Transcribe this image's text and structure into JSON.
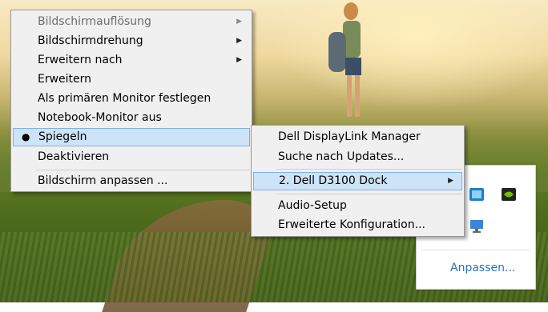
{
  "main_menu": {
    "items": [
      {
        "label": "Bildschirmauflösung",
        "submenu": true,
        "disabled": true
      },
      {
        "label": "Bildschirmdrehung",
        "submenu": true
      },
      {
        "label": "Erweitern nach",
        "submenu": true
      },
      {
        "label": "Erweitern"
      },
      {
        "label": "Als primären Monitor festlegen"
      },
      {
        "label": "Notebook-Monitor aus"
      },
      {
        "label": "Spiegeln",
        "checked": true,
        "selected": true
      },
      {
        "label": "Deaktivieren"
      },
      {
        "label": "Bildschirm anpassen ..."
      }
    ],
    "bullet_glyph": "●",
    "arrow_glyph": "▶"
  },
  "sub_menu": {
    "items": [
      {
        "label": "Dell DisplayLink Manager"
      },
      {
        "label": "Suche nach Updates..."
      },
      {
        "label": "2. Dell D3100 Dock",
        "submenu": true,
        "selected": true
      },
      {
        "label": "Audio-Setup"
      },
      {
        "label": "Erweiterte Konfiguration..."
      }
    ]
  },
  "tray_popup": {
    "icons": [
      "intel-graphics-icon",
      "nvidia-icon",
      "network-monitor-icon"
    ],
    "anpassen_label": "Anpassen..."
  },
  "colors": {
    "selection_bg": "#cde3f7",
    "selection_border": "#7fb2e3",
    "link": "#2a6fc0"
  }
}
